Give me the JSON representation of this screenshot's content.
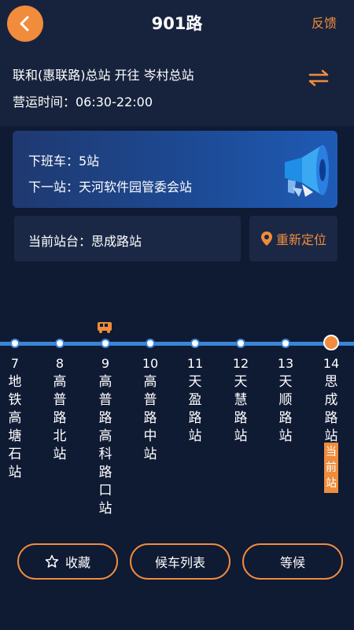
{
  "header": {
    "title": "901路",
    "feedback_label": "反馈",
    "route": "联和(惠联路)总站 开往 岑村总站",
    "hours": "营运时间：06:30-22:00"
  },
  "info": {
    "next_bus": "下班车：5站",
    "next_stop": "下一站：天河软件园管委会站"
  },
  "current_station": "当前站台：思成路站",
  "relocate_label": "重新定位",
  "current_tag": "当前站",
  "stops": [
    {
      "num": "7",
      "name": "地铁高塘石站"
    },
    {
      "num": "8",
      "name": "高普路北站"
    },
    {
      "num": "9",
      "name": "高普路高科路口站"
    },
    {
      "num": "10",
      "name": "高普路中站"
    },
    {
      "num": "11",
      "name": "天盈路站"
    },
    {
      "num": "12",
      "name": "天慧路站"
    },
    {
      "num": "13",
      "name": "天顺路站"
    },
    {
      "num": "14",
      "name": "思成路站"
    }
  ],
  "bottom_buttons": {
    "favorite": "收藏",
    "schedule": "候车列表",
    "wait": "等候"
  },
  "colors": {
    "accent": "#f08c3c",
    "track": "#3a86d8",
    "background": "#0f1a33"
  }
}
